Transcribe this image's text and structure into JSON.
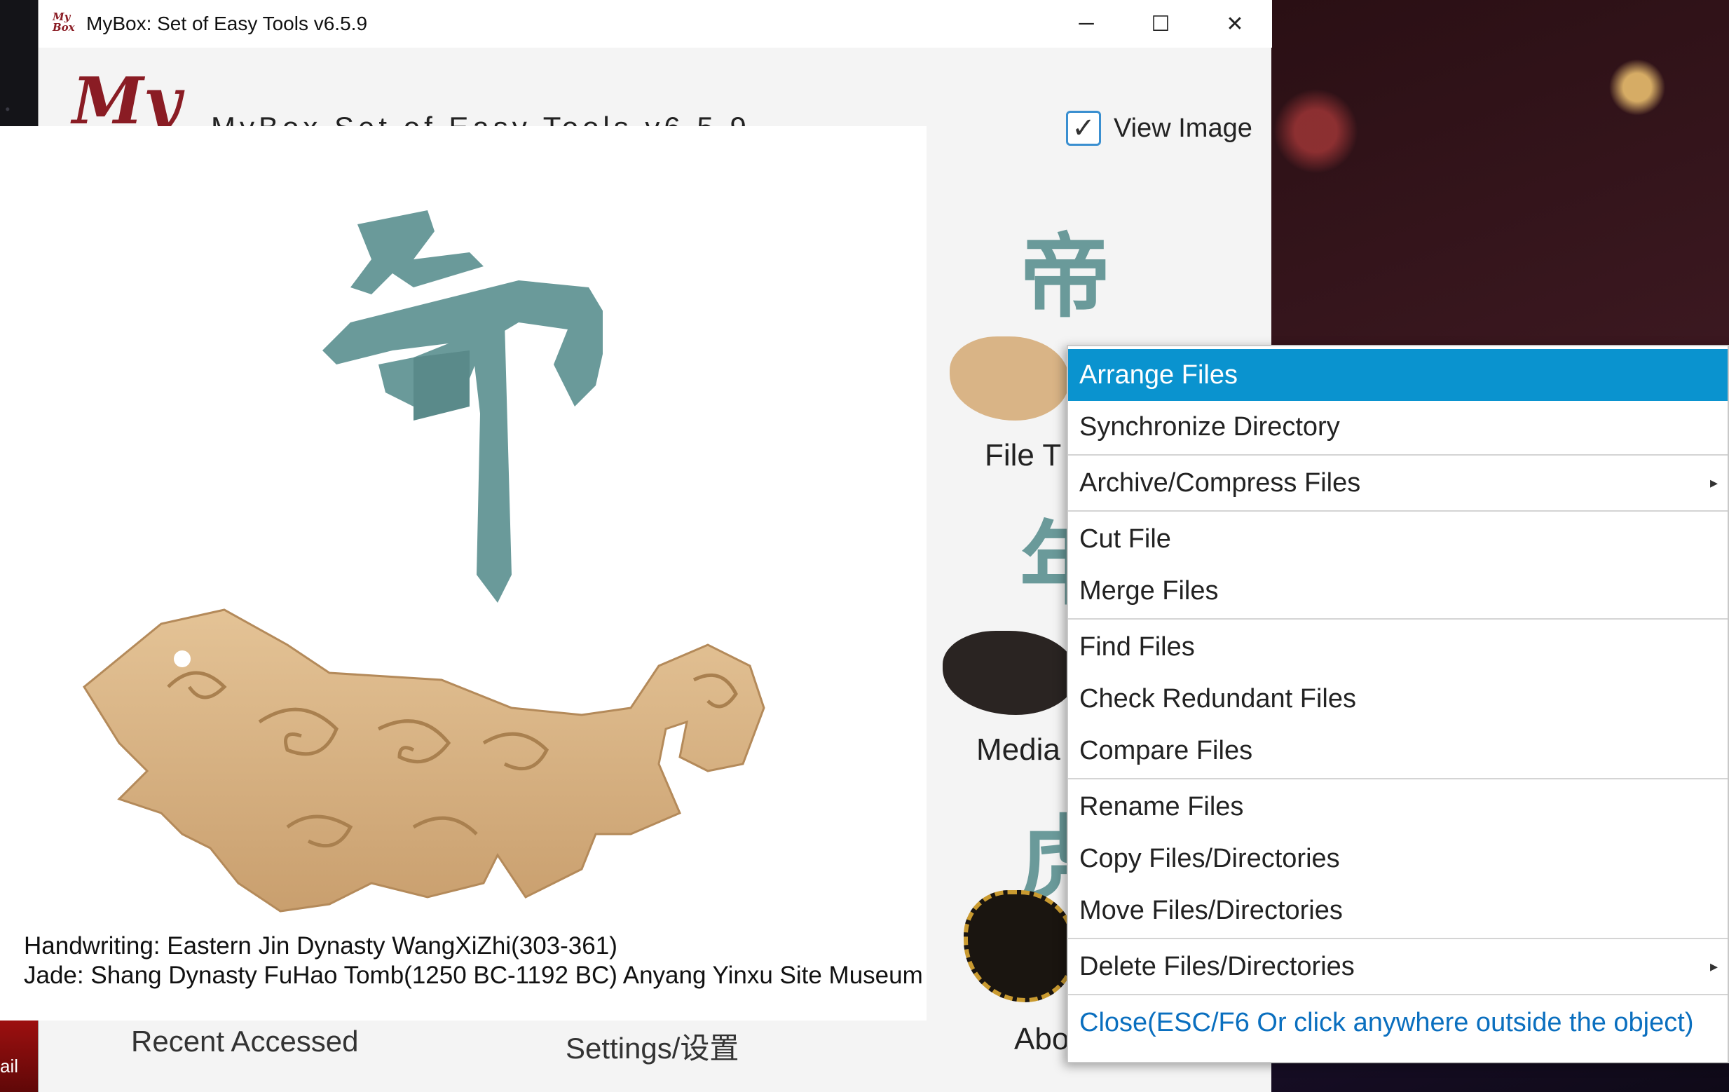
{
  "window": {
    "title": "MyBox: Set of Easy Tools v6.5.9",
    "subtitle": "MyBox Set of Easy Tools v6.5.9",
    "logo_text": "My",
    "icon_text": "My Box",
    "controls": {
      "minimize": "─",
      "maximize": "☐",
      "close": "✕"
    }
  },
  "view_image": {
    "label": "View Image",
    "checked": true,
    "check_glyph": "✓"
  },
  "image_popup": {
    "glyph": "帝",
    "captions": [
      "Handwriting: Eastern Jin Dynasty WangXiZhi(303-361)",
      "Jade: Shang Dynasty FuHao Tomb(1250 BC-1192 BC) Anyang Yinxu Site Museum"
    ]
  },
  "tools": {
    "glyph_top": "帝",
    "glyph_mid": "年",
    "glyph_low": "虎",
    "file_label": "File T",
    "media_label": "Media",
    "about_label": "Abo"
  },
  "bottom_tabs": {
    "recent": "Recent Accessed",
    "settings": "Settings/设置"
  },
  "taskbar": {
    "app_label": "ail"
  },
  "context_menu": {
    "items": [
      {
        "label": "Arrange Files",
        "selected": true
      },
      {
        "label": "Synchronize Directory"
      },
      {
        "label": "Archive/Compress Files",
        "submenu": true
      },
      {
        "label": "Cut File"
      },
      {
        "label": "Merge Files"
      },
      {
        "label": "Find Files"
      },
      {
        "label": "Check Redundant Files"
      },
      {
        "label": "Compare Files"
      },
      {
        "label": "Rename Files"
      },
      {
        "label": "Copy Files/Directories"
      },
      {
        "label": "Move Files/Directories"
      },
      {
        "label": "Delete Files/Directories",
        "submenu": true
      },
      {
        "label": "Close(ESC/F6 Or click anywhere outside the object)"
      }
    ],
    "submenu_glyph": "▸"
  },
  "colors": {
    "accent_selected": "#0a93cf",
    "close_link": "#0a6fbf",
    "logo": "#8a1c24",
    "calligraphy": "#6a9a9a",
    "jade": "#d9b486"
  }
}
